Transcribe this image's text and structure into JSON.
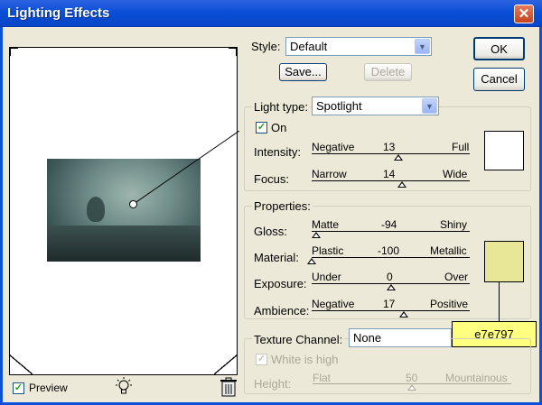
{
  "window": {
    "title": "Lighting Effects",
    "close_glyph": "✕"
  },
  "style": {
    "label": "Style:",
    "value": "Default",
    "save_label": "Save...",
    "delete_label": "Delete"
  },
  "buttons": {
    "ok": "OK",
    "cancel": "Cancel"
  },
  "light": {
    "type_label": "Light type:",
    "type_value": "Spotlight",
    "on_label": "On",
    "on_checked": true,
    "intensity": {
      "label": "Intensity:",
      "min_label": "Negative",
      "value": "13",
      "max_label": "Full",
      "fraction": 0.55
    },
    "focus": {
      "label": "Focus:",
      "min_label": "Narrow",
      "value": "14",
      "max_label": "Wide",
      "fraction": 0.57
    },
    "color": "#ffffff"
  },
  "properties": {
    "title": "Properties:",
    "gloss": {
      "label": "Gloss:",
      "min_label": "Matte",
      "value": "-94",
      "max_label": "Shiny",
      "fraction": 0.03
    },
    "material": {
      "label": "Material:",
      "min_label": "Plastic",
      "value": "-100",
      "max_label": "Metallic",
      "fraction": 0.0
    },
    "exposure": {
      "label": "Exposure:",
      "min_label": "Under",
      "value": "0",
      "max_label": "Over",
      "fraction": 0.5
    },
    "ambience": {
      "label": "Ambience:",
      "min_label": "Negative",
      "value": "17",
      "max_label": "Positive",
      "fraction": 0.58
    },
    "color": "#e7e797"
  },
  "tooltip": {
    "text": "e7e797"
  },
  "texture": {
    "label": "Texture Channel:",
    "value": "None",
    "white_is_high_label": "White is high",
    "white_is_high_checked": true,
    "height": {
      "label": "Height:",
      "min_label": "Flat",
      "value": "50",
      "max_label": "Mountainous",
      "fraction": 0.5
    }
  },
  "footer": {
    "preview_label": "Preview",
    "preview_checked": true,
    "light_icon": "lightbulb-icon",
    "trash_icon": "trash-icon"
  },
  "check_glyph": "✓",
  "arrow_glyph": "▼"
}
